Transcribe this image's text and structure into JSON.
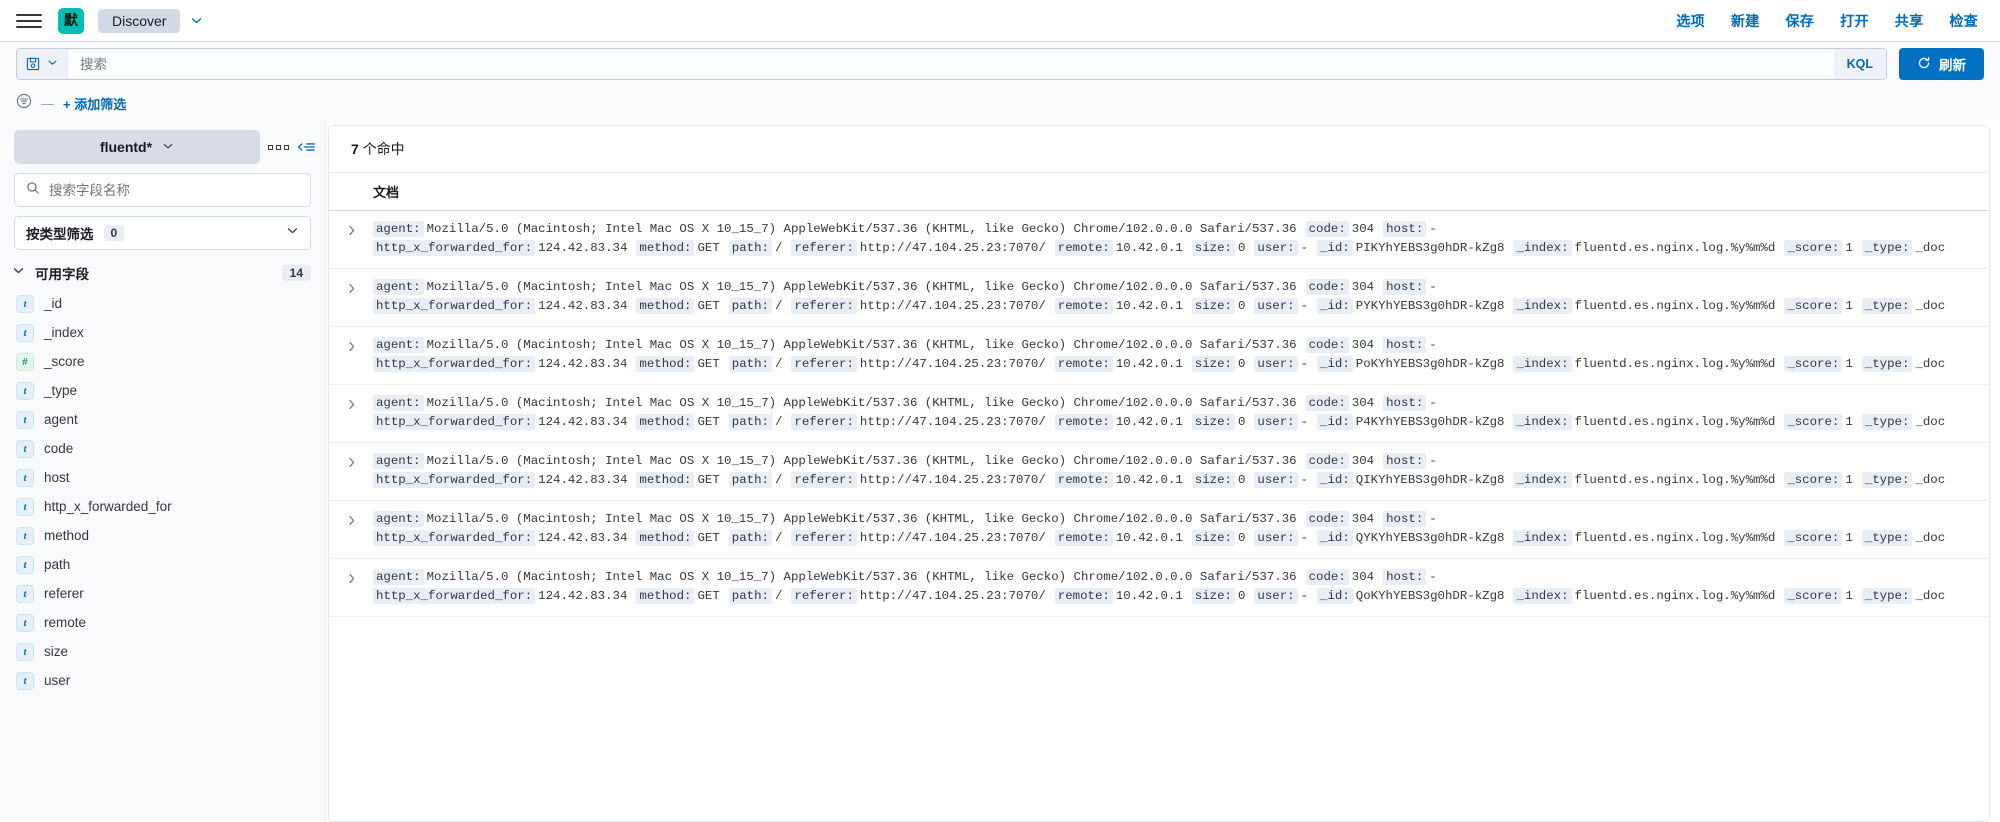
{
  "chrome": {
    "menu_icon": "hamburger-icon",
    "logo_text": "默",
    "tab_label": "Discover",
    "tab_caret_icon": "chevron-down-icon",
    "links": [
      {
        "label": "选项",
        "name": "options"
      },
      {
        "label": "新建",
        "name": "new"
      },
      {
        "label": "保存",
        "name": "save"
      },
      {
        "label": "打开",
        "name": "open"
      },
      {
        "label": "共享",
        "name": "share"
      },
      {
        "label": "检查",
        "name": "inspect"
      }
    ]
  },
  "query_bar": {
    "saved_query_icon": "floppy-disk-icon",
    "saved_query_caret_icon": "chevron-down-icon",
    "search_value": "",
    "search_placeholder": "搜索",
    "language_badge": "KQL",
    "refresh_label": "刷新",
    "refresh_icon": "refresh-icon",
    "refresh_color": "#0071c2"
  },
  "filter_bar": {
    "filter_icon": "filter-icon",
    "dash": "—",
    "add_filter_label": "+ 添加筛选"
  },
  "sidebar": {
    "index_pattern": "fluentd*",
    "index_caret_icon": "chevron-down-icon",
    "dots_icon": "grid-dots-icon",
    "collapse_icon": "collapse-sidebar-icon",
    "field_search_icon": "search-icon",
    "field_search_value": "",
    "field_search_placeholder": "搜索字段名称",
    "type_filter_label": "按类型筛选",
    "type_filter_count": "0",
    "type_filter_caret_icon": "chevron-down-icon",
    "available_fields_label": "可用字段",
    "available_fields_caret_icon": "chevron-down-icon",
    "available_fields_count": "14",
    "fields": [
      {
        "name": "_id",
        "type": "t"
      },
      {
        "name": "_index",
        "type": "t"
      },
      {
        "name": "_score",
        "type": "#"
      },
      {
        "name": "_type",
        "type": "t"
      },
      {
        "name": "agent",
        "type": "t"
      },
      {
        "name": "code",
        "type": "t"
      },
      {
        "name": "host",
        "type": "t"
      },
      {
        "name": "http_x_forwarded_for",
        "type": "t"
      },
      {
        "name": "method",
        "type": "t"
      },
      {
        "name": "path",
        "type": "t"
      },
      {
        "name": "referer",
        "type": "t"
      },
      {
        "name": "remote",
        "type": "t"
      },
      {
        "name": "size",
        "type": "t"
      },
      {
        "name": "user",
        "type": "t"
      }
    ]
  },
  "results": {
    "hits_count": "7",
    "hits_label": "个命中",
    "column_header": "文档",
    "expand_icon": "chevron-right-icon",
    "rows": [
      {
        "fields": [
          {
            "key": "agent:",
            "value": "Mozilla/5.0 (Macintosh; Intel Mac OS X 10_15_7) AppleWebKit/537.36 (KHTML, like Gecko) Chrome/102.0.0.0 Safari/537.36"
          },
          {
            "key": "code:",
            "value": "304"
          },
          {
            "key": "host:",
            "value": "-"
          },
          {
            "key": "http_x_forwarded_for:",
            "value": "124.42.83.34"
          },
          {
            "key": "method:",
            "value": "GET"
          },
          {
            "key": "path:",
            "value": "/"
          },
          {
            "key": "referer:",
            "value": "http://47.104.25.23:7070/"
          },
          {
            "key": "remote:",
            "value": "10.42.0.1"
          },
          {
            "key": "size:",
            "value": "0"
          },
          {
            "key": "user:",
            "value": "-"
          },
          {
            "key": "_id:",
            "value": "PIKYhYEBS3g0hDR-kZg8"
          },
          {
            "key": "_index:",
            "value": "fluentd.es.nginx.log.%y%m%d"
          },
          {
            "key": "_score:",
            "value": "1"
          },
          {
            "key": "_type:",
            "value": "_doc"
          }
        ]
      },
      {
        "fields": [
          {
            "key": "agent:",
            "value": "Mozilla/5.0 (Macintosh; Intel Mac OS X 10_15_7) AppleWebKit/537.36 (KHTML, like Gecko) Chrome/102.0.0.0 Safari/537.36"
          },
          {
            "key": "code:",
            "value": "304"
          },
          {
            "key": "host:",
            "value": "-"
          },
          {
            "key": "http_x_forwarded_for:",
            "value": "124.42.83.34"
          },
          {
            "key": "method:",
            "value": "GET"
          },
          {
            "key": "path:",
            "value": "/"
          },
          {
            "key": "referer:",
            "value": "http://47.104.25.23:7070/"
          },
          {
            "key": "remote:",
            "value": "10.42.0.1"
          },
          {
            "key": "size:",
            "value": "0"
          },
          {
            "key": "user:",
            "value": "-"
          },
          {
            "key": "_id:",
            "value": "PYKYhYEBS3g0hDR-kZg8"
          },
          {
            "key": "_index:",
            "value": "fluentd.es.nginx.log.%y%m%d"
          },
          {
            "key": "_score:",
            "value": "1"
          },
          {
            "key": "_type:",
            "value": "_doc"
          }
        ]
      },
      {
        "fields": [
          {
            "key": "agent:",
            "value": "Mozilla/5.0 (Macintosh; Intel Mac OS X 10_15_7) AppleWebKit/537.36 (KHTML, like Gecko) Chrome/102.0.0.0 Safari/537.36"
          },
          {
            "key": "code:",
            "value": "304"
          },
          {
            "key": "host:",
            "value": "-"
          },
          {
            "key": "http_x_forwarded_for:",
            "value": "124.42.83.34"
          },
          {
            "key": "method:",
            "value": "GET"
          },
          {
            "key": "path:",
            "value": "/"
          },
          {
            "key": "referer:",
            "value": "http://47.104.25.23:7070/"
          },
          {
            "key": "remote:",
            "value": "10.42.0.1"
          },
          {
            "key": "size:",
            "value": "0"
          },
          {
            "key": "user:",
            "value": "-"
          },
          {
            "key": "_id:",
            "value": "PoKYhYEBS3g0hDR-kZg8"
          },
          {
            "key": "_index:",
            "value": "fluentd.es.nginx.log.%y%m%d"
          },
          {
            "key": "_score:",
            "value": "1"
          },
          {
            "key": "_type:",
            "value": "_doc"
          }
        ]
      },
      {
        "fields": [
          {
            "key": "agent:",
            "value": "Mozilla/5.0 (Macintosh; Intel Mac OS X 10_15_7) AppleWebKit/537.36 (KHTML, like Gecko) Chrome/102.0.0.0 Safari/537.36"
          },
          {
            "key": "code:",
            "value": "304"
          },
          {
            "key": "host:",
            "value": "-"
          },
          {
            "key": "http_x_forwarded_for:",
            "value": "124.42.83.34"
          },
          {
            "key": "method:",
            "value": "GET"
          },
          {
            "key": "path:",
            "value": "/"
          },
          {
            "key": "referer:",
            "value": "http://47.104.25.23:7070/"
          },
          {
            "key": "remote:",
            "value": "10.42.0.1"
          },
          {
            "key": "size:",
            "value": "0"
          },
          {
            "key": "user:",
            "value": "-"
          },
          {
            "key": "_id:",
            "value": "P4KYhYEBS3g0hDR-kZg8"
          },
          {
            "key": "_index:",
            "value": "fluentd.es.nginx.log.%y%m%d"
          },
          {
            "key": "_score:",
            "value": "1"
          },
          {
            "key": "_type:",
            "value": "_doc"
          }
        ]
      },
      {
        "fields": [
          {
            "key": "agent:",
            "value": "Mozilla/5.0 (Macintosh; Intel Mac OS X 10_15_7) AppleWebKit/537.36 (KHTML, like Gecko) Chrome/102.0.0.0 Safari/537.36"
          },
          {
            "key": "code:",
            "value": "304"
          },
          {
            "key": "host:",
            "value": "-"
          },
          {
            "key": "http_x_forwarded_for:",
            "value": "124.42.83.34"
          },
          {
            "key": "method:",
            "value": "GET"
          },
          {
            "key": "path:",
            "value": "/"
          },
          {
            "key": "referer:",
            "value": "http://47.104.25.23:7070/"
          },
          {
            "key": "remote:",
            "value": "10.42.0.1"
          },
          {
            "key": "size:",
            "value": "0"
          },
          {
            "key": "user:",
            "value": "-"
          },
          {
            "key": "_id:",
            "value": "QIKYhYEBS3g0hDR-kZg8"
          },
          {
            "key": "_index:",
            "value": "fluentd.es.nginx.log.%y%m%d"
          },
          {
            "key": "_score:",
            "value": "1"
          },
          {
            "key": "_type:",
            "value": "_doc"
          }
        ]
      },
      {
        "fields": [
          {
            "key": "agent:",
            "value": "Mozilla/5.0 (Macintosh; Intel Mac OS X 10_15_7) AppleWebKit/537.36 (KHTML, like Gecko) Chrome/102.0.0.0 Safari/537.36"
          },
          {
            "key": "code:",
            "value": "304"
          },
          {
            "key": "host:",
            "value": "-"
          },
          {
            "key": "http_x_forwarded_for:",
            "value": "124.42.83.34"
          },
          {
            "key": "method:",
            "value": "GET"
          },
          {
            "key": "path:",
            "value": "/"
          },
          {
            "key": "referer:",
            "value": "http://47.104.25.23:7070/"
          },
          {
            "key": "remote:",
            "value": "10.42.0.1"
          },
          {
            "key": "size:",
            "value": "0"
          },
          {
            "key": "user:",
            "value": "-"
          },
          {
            "key": "_id:",
            "value": "QYKYhYEBS3g0hDR-kZg8"
          },
          {
            "key": "_index:",
            "value": "fluentd.es.nginx.log.%y%m%d"
          },
          {
            "key": "_score:",
            "value": "1"
          },
          {
            "key": "_type:",
            "value": "_doc"
          }
        ]
      },
      {
        "fields": [
          {
            "key": "agent:",
            "value": "Mozilla/5.0 (Macintosh; Intel Mac OS X 10_15_7) AppleWebKit/537.36 (KHTML, like Gecko) Chrome/102.0.0.0 Safari/537.36"
          },
          {
            "key": "code:",
            "value": "304"
          },
          {
            "key": "host:",
            "value": "-"
          },
          {
            "key": "http_x_forwarded_for:",
            "value": "124.42.83.34"
          },
          {
            "key": "method:",
            "value": "GET"
          },
          {
            "key": "path:",
            "value": "/"
          },
          {
            "key": "referer:",
            "value": "http://47.104.25.23:7070/"
          },
          {
            "key": "remote:",
            "value": "10.42.0.1"
          },
          {
            "key": "size:",
            "value": "0"
          },
          {
            "key": "user:",
            "value": "-"
          },
          {
            "key": "_id:",
            "value": "QoKYhYEBS3g0hDR-kZg8"
          },
          {
            "key": "_index:",
            "value": "fluentd.es.nginx.log.%y%m%d"
          },
          {
            "key": "_score:",
            "value": "1"
          },
          {
            "key": "_type:",
            "value": "_doc"
          }
        ]
      }
    ]
  }
}
